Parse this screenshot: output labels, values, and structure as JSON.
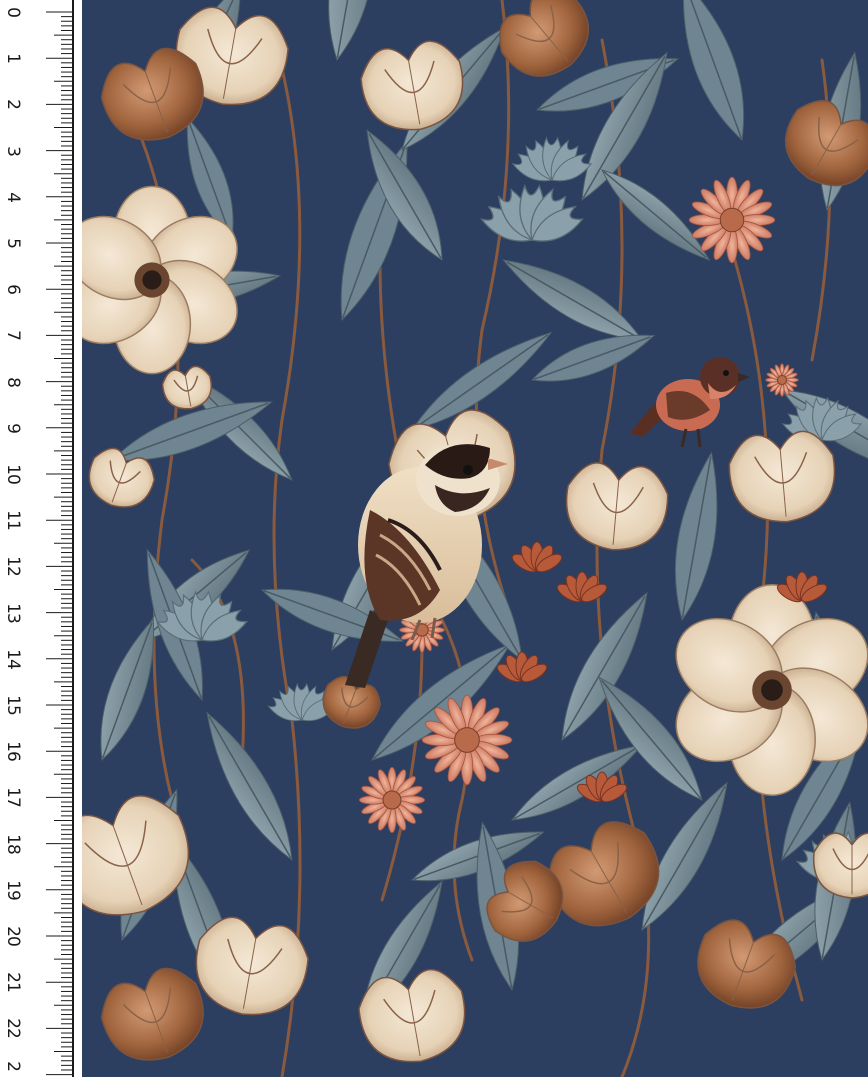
{
  "ruler": {
    "unit": "cm",
    "labels": [
      "0",
      "1",
      "2",
      "3",
      "4",
      "5",
      "6",
      "7",
      "8",
      "9",
      "10",
      "11",
      "12",
      "13",
      "14",
      "15",
      "16",
      "17",
      "18",
      "19",
      "20",
      "21",
      "22",
      "2"
    ]
  },
  "pattern": {
    "description_colors": {
      "background": "#2c3f60",
      "leaf": "#7f95a0",
      "leaf_dark": "#5e737e",
      "cream": "#eddcc4",
      "cream_shade": "#c9b092",
      "copper": "#9a5c3c",
      "brown": "#6f4128",
      "coral": "#d98c72",
      "rust": "#b75a3a"
    }
  }
}
